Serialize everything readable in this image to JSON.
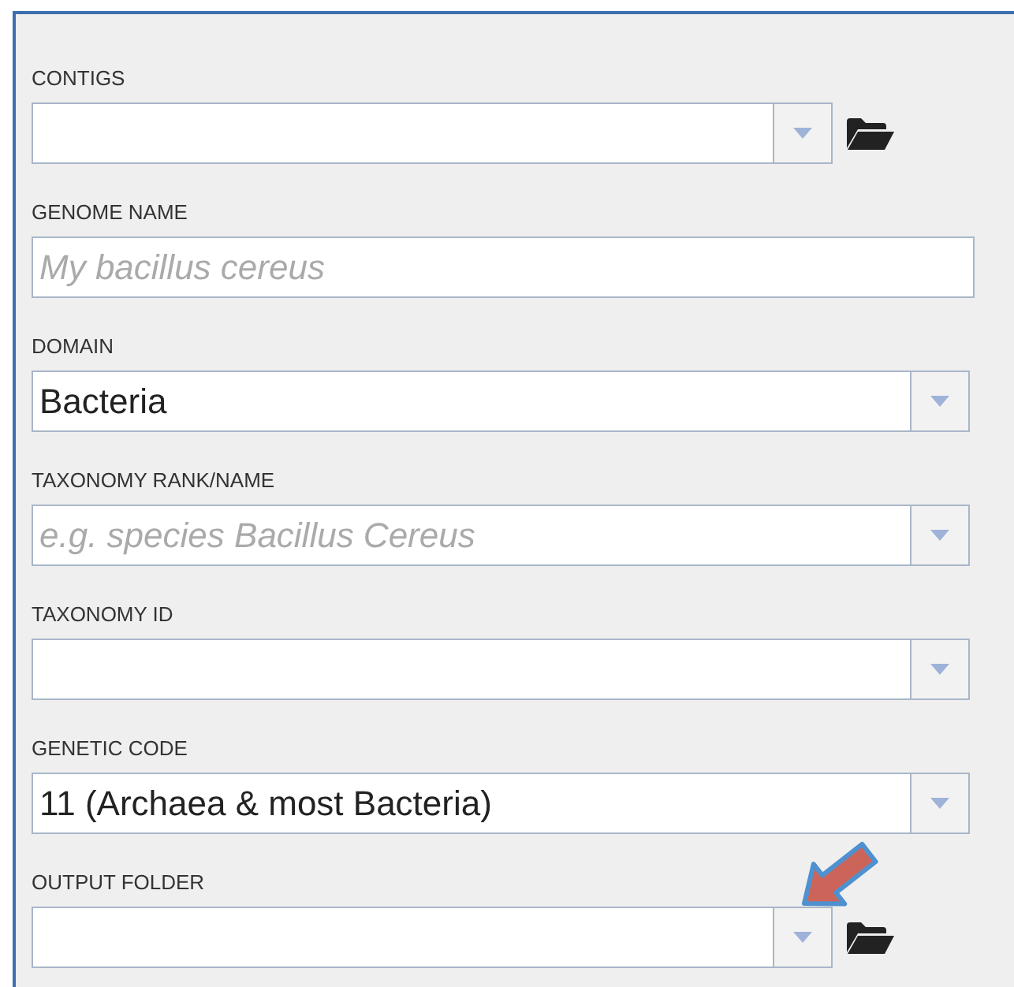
{
  "fields": [
    {
      "label": "CONTIGS",
      "kind": "combo",
      "browse": true,
      "highlighted": false
    },
    {
      "label": "GENOME NAME",
      "kind": "text",
      "placeholder": "My bacillus cereus",
      "browse": false,
      "highlighted": false
    },
    {
      "label": "DOMAIN",
      "kind": "combo",
      "value": "Bacteria",
      "browse": false,
      "highlighted": false
    },
    {
      "label": "TAXONOMY RANK/NAME",
      "kind": "combo",
      "placeholder": "e.g. species Bacillus Cereus",
      "browse": false,
      "highlighted": false
    },
    {
      "label": "TAXONOMY ID",
      "kind": "combo",
      "browse": false,
      "highlighted": false
    },
    {
      "label": "GENETIC CODE",
      "kind": "combo",
      "value": "11 (Archaea & most Bacteria)",
      "browse": false,
      "highlighted": false
    },
    {
      "label": "OUTPUT FOLDER",
      "kind": "combo",
      "browse": true,
      "highlighted": true
    }
  ]
}
